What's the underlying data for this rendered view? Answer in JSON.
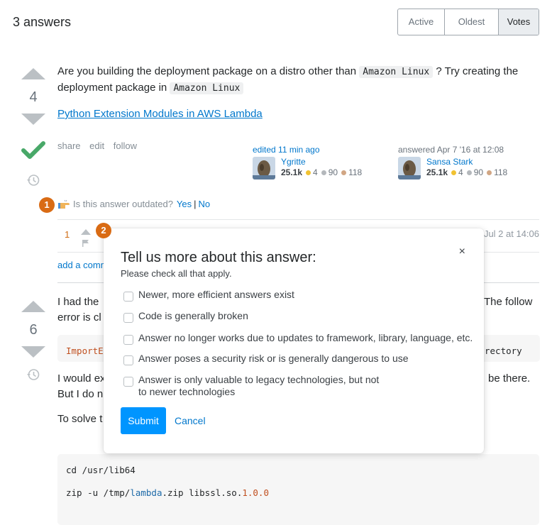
{
  "header": {
    "answers_count": "3 answers",
    "sort_tabs": [
      {
        "label": "Active",
        "active": false
      },
      {
        "label": "Oldest",
        "active": false
      },
      {
        "label": "Votes",
        "active": true
      }
    ]
  },
  "answer1": {
    "votes": "4",
    "accepted": true,
    "body_part1": "Are you building the deployment package on a distro other than ",
    "code1": "Amazon Linux",
    "body_part2": " ? Try creating the deployment package in ",
    "code2": "Amazon Linux",
    "link_text": "Python Extension Modules in AWS Lambda",
    "menu": [
      "share",
      "edit",
      "follow"
    ],
    "edited": {
      "action": "edited 11 min ago",
      "user": "Ygritte",
      "rep": "25.1k",
      "gold": "4",
      "silver": "90",
      "bronze": "118"
    },
    "answered": {
      "action": "answered Apr 7 '16 at 12:08",
      "user": "Sansa Stark",
      "rep": "25.1k",
      "gold": "4",
      "silver": "90",
      "bronze": "118"
    },
    "outdated_prompt": "Is this answer outdated?",
    "outdated_yes": "Yes",
    "outdated_sep": "|",
    "outdated_no": "No",
    "comment": {
      "score": "1",
      "date": "Jul 2 at 14:06"
    },
    "add_comment": "add a comment"
  },
  "answer2": {
    "votes": "6",
    "line1_left": "I had the",
    "line1_right": "The follow",
    "line2_left": "error is cl",
    "error_left": "ImportE",
    "error_right": "rectory",
    "para2_left": "I would ex",
    "para2_right": "be there.",
    "para2_line2": "But I do n",
    "para3": "To solve t",
    "code_line1": "cd /usr/lib64",
    "code_line2_a": "zip -u /tmp/",
    "code_line2_b": "lambda",
    "code_line2_c": ".zip libssl.so.",
    "code_line2_d": "1.0.0"
  },
  "markers": [
    "1",
    "2"
  ],
  "colors": {
    "accent": "#0077cc",
    "submit": "#0095ff",
    "accepted": "#48a868",
    "marker": "#d96b14",
    "gold": "#f1c232",
    "silver": "#b4b8bc",
    "bronze": "#d1a684"
  },
  "popup": {
    "title": "Tell us more about this answer:",
    "subtitle": "Please check all that apply.",
    "close_icon": "×",
    "options": [
      {
        "label": "Newer, more efficient answers exist",
        "checked": false
      },
      {
        "label": "Code is generally broken",
        "checked": false
      },
      {
        "label": "Answer no longer works due to updates to framework, library, language, etc.",
        "checked": false
      },
      {
        "label": "Answer poses a security risk or is generally dangerous to use",
        "checked": false
      },
      {
        "label": "Answer is only valuable to legacy technologies, but not to newer technologies",
        "checked": false
      }
    ],
    "submit": "Submit",
    "cancel": "Cancel"
  }
}
